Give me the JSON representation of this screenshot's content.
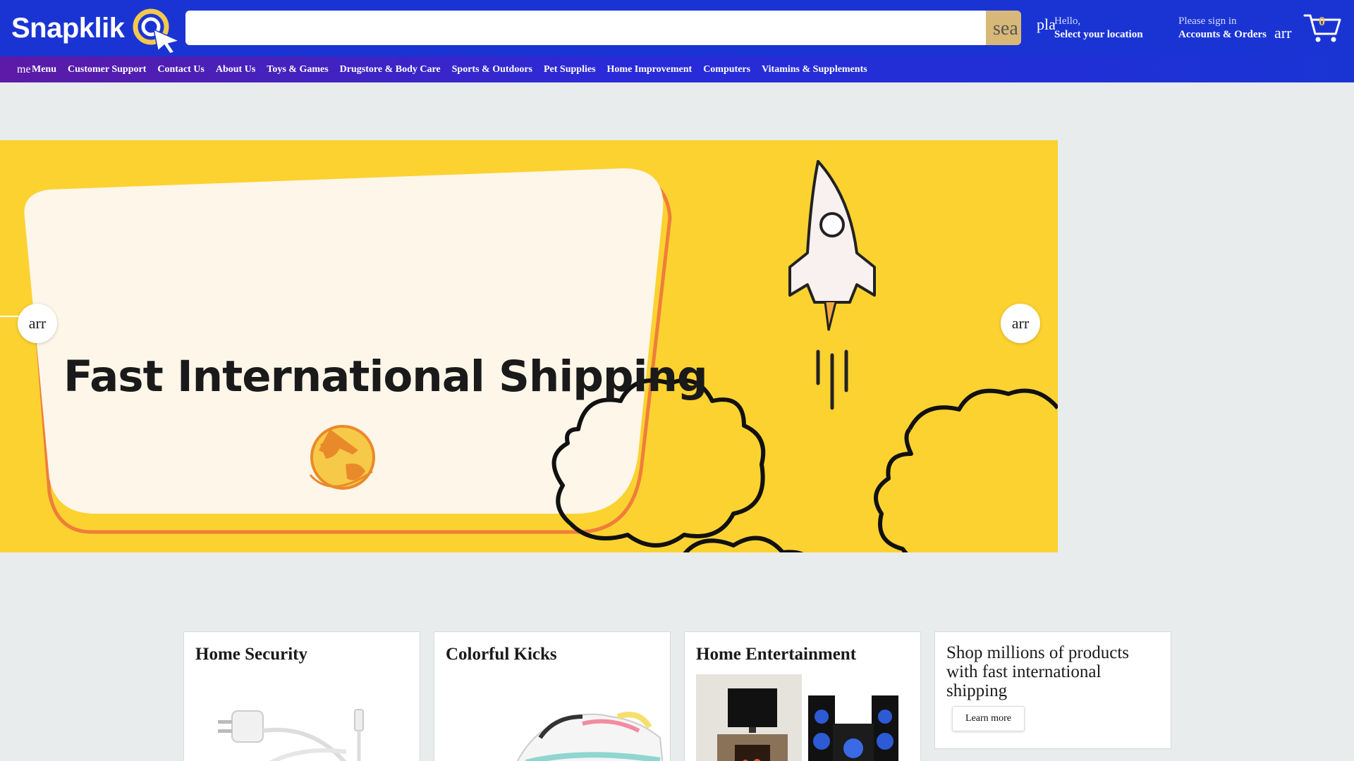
{
  "brand": {
    "logo_text": "Snapklik"
  },
  "search": {
    "placeholder": "",
    "button_icon_text": "sea"
  },
  "location": {
    "icon_text": "pla",
    "hello": "Hello,",
    "select": "Select your location"
  },
  "account": {
    "sign_in": "Please sign in",
    "label": "Accounts & Orders",
    "arrow_icon_text": "arr"
  },
  "cart": {
    "count": "0"
  },
  "nav": {
    "menu_icon_text": "me",
    "menu_label": "Menu",
    "items": [
      "Customer Support",
      "Contact Us",
      "About Us",
      "Toys & Games",
      "Drugstore & Body Care",
      "Sports & Outdoors",
      "Pet Supplies",
      "Home Improvement",
      "Computers",
      "Vitamins & Supplements"
    ]
  },
  "hero": {
    "title": "Fast International Shipping",
    "prev_icon_text": "arr",
    "next_icon_text": "arr"
  },
  "cards": [
    {
      "title": "Home Security"
    },
    {
      "title": "Colorful Kicks"
    },
    {
      "title": "Home Entertainment"
    }
  ],
  "promo": {
    "text": "Shop millions of products with fast international shipping",
    "button": "Learn more"
  },
  "colors": {
    "header": "#1a34d4",
    "hero_bg": "#fcd230",
    "accent": "#f2c94c"
  }
}
